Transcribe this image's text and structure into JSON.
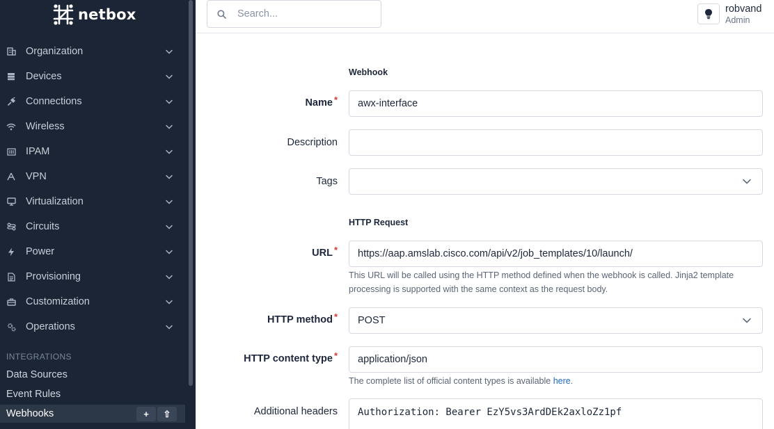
{
  "brand": {
    "name": "netbox"
  },
  "search": {
    "placeholder": "Search..."
  },
  "user": {
    "name": "robvand",
    "role": "Admin"
  },
  "sidebar": {
    "items": [
      {
        "label": "Organization",
        "icon": "building-icon"
      },
      {
        "label": "Devices",
        "icon": "server-icon"
      },
      {
        "label": "Connections",
        "icon": "plug-icon"
      },
      {
        "label": "Wireless",
        "icon": "wifi-icon"
      },
      {
        "label": "IPAM",
        "icon": "counter-icon"
      },
      {
        "label": "VPN",
        "icon": "tunnel-icon"
      },
      {
        "label": "Virtualization",
        "icon": "monitor-icon"
      },
      {
        "label": "Circuits",
        "icon": "transit-icon"
      },
      {
        "label": "Power",
        "icon": "bolt-icon"
      },
      {
        "label": "Provisioning",
        "icon": "file-icon"
      },
      {
        "label": "Customization",
        "icon": "toolbox-icon"
      },
      {
        "label": "Operations",
        "icon": "cogs-icon"
      }
    ],
    "section": "INTEGRATIONS",
    "sub_items": [
      {
        "label": "Data Sources"
      },
      {
        "label": "Event Rules"
      },
      {
        "label": "Webhooks"
      }
    ],
    "add_label": "+",
    "import_label": "⇧"
  },
  "form": {
    "webhook_section": "Webhook",
    "name_label": "Name",
    "name_value": "awx-interface",
    "description_label": "Description",
    "description_value": "",
    "tags_label": "Tags",
    "tags_value": "",
    "http_section": "HTTP Request",
    "url_label": "URL",
    "url_value": "https://aap.amslab.cisco.com/api/v2/job_templates/10/launch/",
    "url_help": "This URL will be called using the HTTP method defined when the webhook is called. Jinja2 template processing is supported with the same context as the request body.",
    "method_label": "HTTP method",
    "method_value": "POST",
    "content_type_label": "HTTP content type",
    "content_type_value": "application/json",
    "content_type_help": "The complete list of official content types is available",
    "content_type_help_link": "here",
    "content_type_help_end": ".",
    "headers_label": "Additional headers",
    "headers_value": "Authorization: Bearer EzY5vs3ArdDEk2axloZz1pf"
  }
}
